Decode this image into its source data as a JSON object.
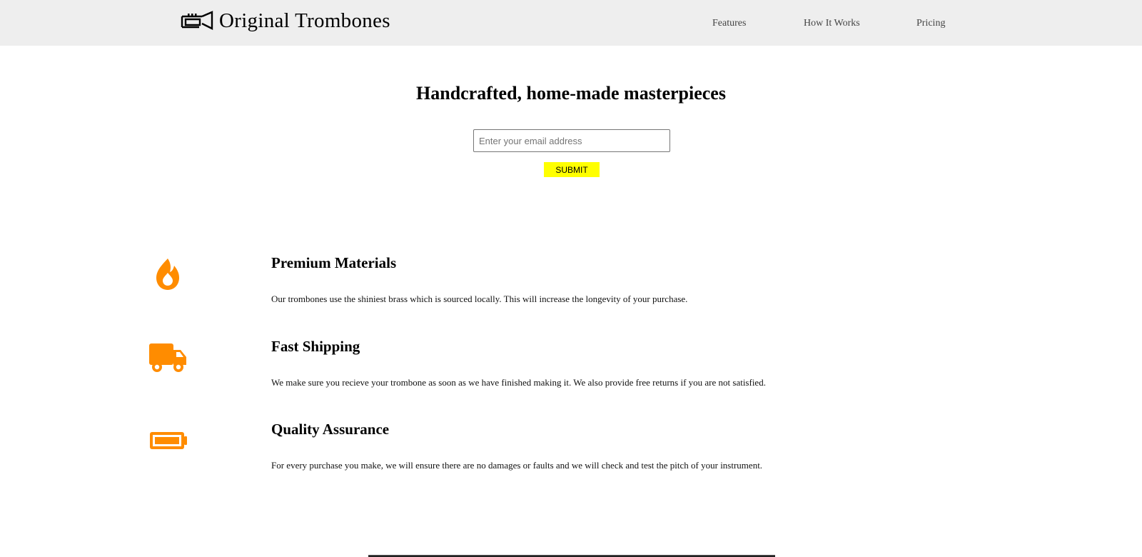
{
  "header": {
    "brand": "Original Trombones",
    "logo_icon": "trombone-icon",
    "nav": [
      "Features",
      "How It Works",
      "Pricing"
    ]
  },
  "hero": {
    "title": "Handcrafted, home-made masterpieces",
    "email_placeholder": "Enter your email address",
    "submit_label": "SUBMIT"
  },
  "features": [
    {
      "icon": "fire-icon",
      "title": "Premium Materials",
      "description": "Our trombones use the shiniest brass which is sourced locally. This will increase the longevity of your purchase."
    },
    {
      "icon": "truck-icon",
      "title": "Fast Shipping",
      "description": "We make sure you recieve your trombone as soon as we have finished making it. We also provide free returns if you are not satisfied."
    },
    {
      "icon": "battery-full-icon",
      "title": "Quality Assurance",
      "description": "For every purchase you make, we will ensure there are no damages or faults and we will check and test the pitch of your instrument."
    }
  ],
  "colors": {
    "header_bg": "#eeeeee",
    "accent_orange": "#ff8c00",
    "submit_bg": "#ffff00"
  }
}
